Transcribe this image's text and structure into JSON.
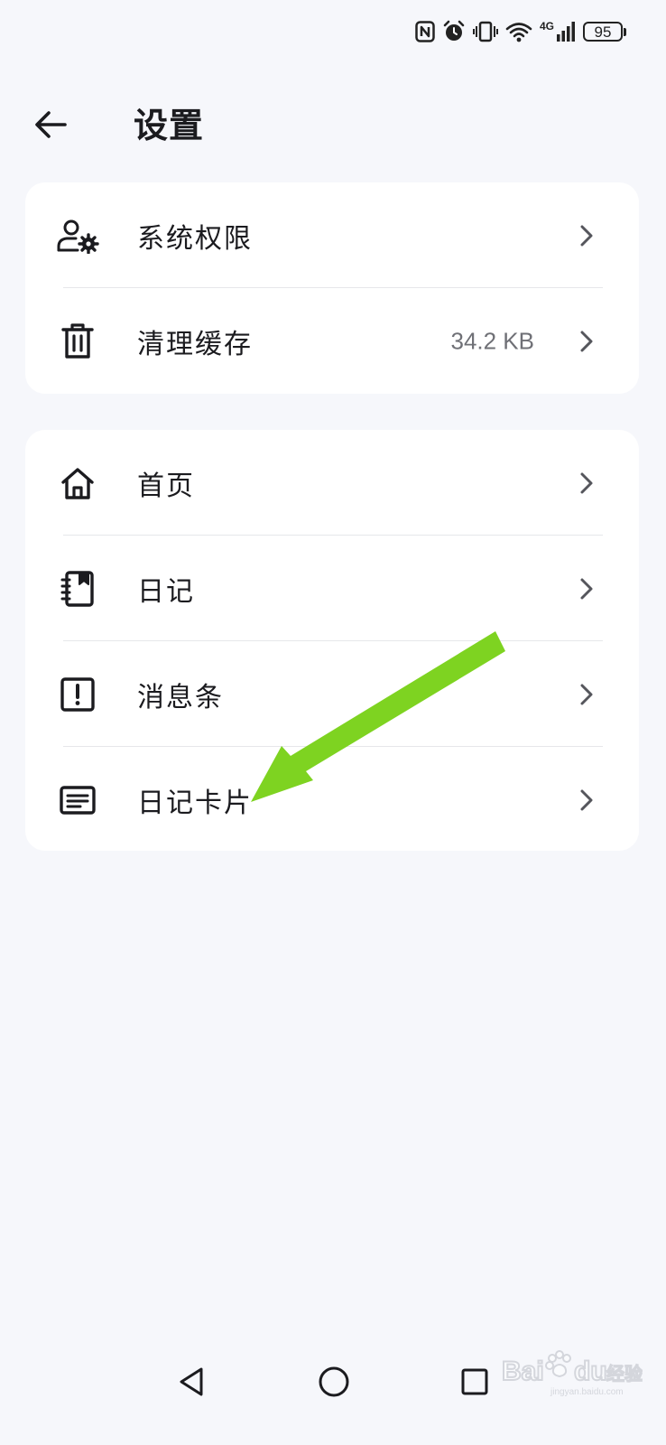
{
  "status_bar": {
    "icons": [
      "nfc-icon",
      "alarm-icon",
      "vibrate-icon",
      "wifi-icon",
      "signal-4g-icon",
      "battery-icon"
    ],
    "network_label": "4G",
    "battery_level": "95"
  },
  "header": {
    "title": "设置",
    "back_icon": "arrow-left-icon"
  },
  "groups": [
    {
      "items": [
        {
          "icon": "user-settings-icon",
          "label": "系统权限"
        },
        {
          "icon": "trash-icon",
          "label": "清理缓存",
          "value": "34.2 KB"
        }
      ]
    },
    {
      "items": [
        {
          "icon": "home-icon",
          "label": "首页"
        },
        {
          "icon": "diary-icon",
          "label": "日记"
        },
        {
          "icon": "alert-square-icon",
          "label": "消息条"
        },
        {
          "icon": "card-icon",
          "label": "日记卡片"
        }
      ]
    }
  ],
  "watermark": {
    "text": "Baidu 经验",
    "subtext": "jingyan.baidu.com"
  },
  "colors": {
    "background": "#f6f7fb",
    "card": "#ffffff",
    "text": "#1b1b1f",
    "secondary_text": "#6f7076",
    "annotation_arrow": "#7ed321"
  }
}
